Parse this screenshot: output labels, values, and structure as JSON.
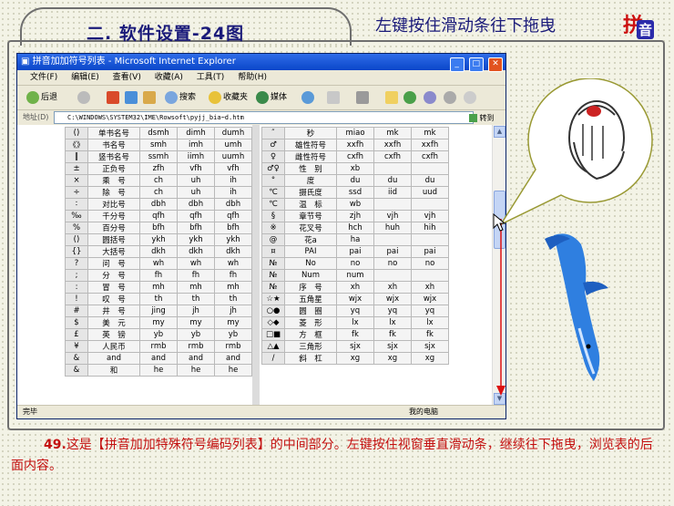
{
  "header": {
    "title": "二. 软件设置-24图",
    "hint": "左键按住滑动条往下拖曳",
    "logo_top": "拼",
    "logo_bottom": "音"
  },
  "ie": {
    "title": "拼音加加符号列表 - Microsoft Internet Explorer",
    "menu": [
      "文件(F)",
      "编辑(E)",
      "查看(V)",
      "收藏(A)",
      "工具(T)",
      "帮助(H)"
    ],
    "toolbar": {
      "back": "后退",
      "search": "搜索",
      "favorites": "收藏夹",
      "media": "媒体"
    },
    "address_label": "地址(D)",
    "address": "C:\\WINDOWS\\SYSTEM32\\IME\\Rowsoft\\pyjj_bia~d.htm",
    "go": "转到",
    "status_left": "完毕",
    "status_right": "我的电脑"
  },
  "table_left": [
    [
      "()",
      "单书名号",
      "dsmh",
      "dimh",
      "dumh"
    ],
    [
      "《》",
      "书名号",
      "smh",
      "imh",
      "umh"
    ],
    [
      "‖",
      "竖书名号",
      "ssmh",
      "iimh",
      "uumh"
    ],
    [
      "±",
      "正负号",
      "zfh",
      "vfh",
      "vfh"
    ],
    [
      "×",
      "乘　号",
      "ch",
      "uh",
      "ih"
    ],
    [
      "÷",
      "除　号",
      "ch",
      "uh",
      "ih"
    ],
    [
      "∶",
      "对比号",
      "dbh",
      "dbh",
      "dbh"
    ],
    [
      "‰",
      "千分号",
      "qfh",
      "qfh",
      "qfh"
    ],
    [
      "%",
      "百分号",
      "bfh",
      "bfh",
      "bfh"
    ],
    [
      "()",
      "圆括号",
      "ykh",
      "ykh",
      "ykh"
    ],
    [
      "{}",
      "大括号",
      "dkh",
      "dkh",
      "dkh"
    ],
    [
      "?",
      "问　号",
      "wh",
      "wh",
      "wh"
    ],
    [
      ";",
      "分　号",
      "fh",
      "fh",
      "fh"
    ],
    [
      ":",
      "冒　号",
      "mh",
      "mh",
      "mh"
    ],
    [
      "!",
      "叹　号",
      "th",
      "th",
      "th"
    ],
    [
      "#",
      "井　号",
      "jing",
      "jh",
      "jh"
    ],
    [
      "$",
      "美　元",
      "my",
      "my",
      "my"
    ],
    [
      "£",
      "英　镑",
      "yb",
      "yb",
      "yb"
    ],
    [
      "¥",
      "人民币",
      "rmb",
      "rmb",
      "rmb"
    ],
    [
      "&",
      "and",
      "and",
      "and",
      "and"
    ],
    [
      "&",
      "和",
      "he",
      "he",
      "he"
    ]
  ],
  "table_right": [
    [
      "″",
      "秒",
      "miao",
      "mk",
      "mk"
    ],
    [
      "♂",
      "雄性符号",
      "xxfh",
      "xxfh",
      "xxfh"
    ],
    [
      "♀",
      "雌性符号",
      "cxfh",
      "cxfh",
      "cxfh"
    ],
    [
      "♂♀",
      "性　别",
      "xb",
      "",
      ""
    ],
    [
      "°",
      "度",
      "du",
      "du",
      "du"
    ],
    [
      "℃",
      "摄氏度",
      "ssd",
      "iid",
      "uud"
    ],
    [
      "℃",
      "温　标",
      "wb",
      "",
      ""
    ],
    [
      "§",
      "章节号",
      "zjh",
      "vjh",
      "vjh"
    ],
    [
      "※",
      "花叉号",
      "hch",
      "huh",
      "hih"
    ],
    [
      "@",
      "花a",
      "ha",
      "",
      ""
    ],
    [
      "¤",
      "PAI",
      "pai",
      "pai",
      "pai"
    ],
    [
      "№",
      "No",
      "no",
      "no",
      "no"
    ],
    [
      "№",
      "Num",
      "num",
      "",
      ""
    ],
    [
      "№",
      "序　号",
      "xh",
      "xh",
      "xh"
    ],
    [
      "☆★",
      "五角星",
      "wjx",
      "wjx",
      "wjx"
    ],
    [
      "○●",
      "圆　圈",
      "yq",
      "yq",
      "yq"
    ],
    [
      "◇◆",
      "菱　形",
      "lx",
      "lx",
      "lx"
    ],
    [
      "□■",
      "方　框",
      "fk",
      "fk",
      "fk"
    ],
    [
      "△▲",
      "三角形",
      "sjx",
      "sjx",
      "sjx"
    ],
    [
      "/",
      "斜　杠",
      "xg",
      "xg",
      "xg"
    ]
  ],
  "caption": {
    "number": "49.",
    "text": "这是【拼音加加特殊符号编码列表】的中间部分。左键按住视窗垂直滑动条，继续往下拖曳，浏览表的后面内容。"
  }
}
